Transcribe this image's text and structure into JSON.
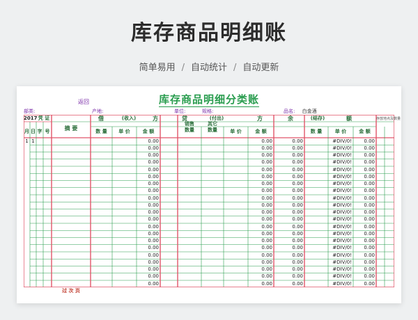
{
  "page": {
    "title": "库存商品明细账",
    "subtitle_items": [
      "简单易用",
      "自动统计",
      "自动更新"
    ],
    "subtitle_sep": "/"
  },
  "sheet": {
    "return_link": "返回",
    "ledger_title": "库存商品明细分类账",
    "info": {
      "dept_label": "部类:",
      "origin_label": "产地:",
      "unit_label": "单位:",
      "spec_label": "规格:",
      "product_label": "品名:",
      "product_value": "白金酒"
    },
    "header": {
      "year": "2017",
      "voucher": "凭  证",
      "month": "月",
      "day": "日",
      "zi": "字",
      "hao": "号",
      "summary": "摘  要",
      "debit": "借",
      "debit_note": "(收入)",
      "debit_fang": "方",
      "credit": "贷",
      "credit_note": "(付出)",
      "credit_fang": "方",
      "balance": "余",
      "balance_note": "(结存)",
      "balance_e": "额",
      "storage": "存放地点及数量",
      "qty": "数 量",
      "unit_price": "单 价",
      "amount": "金 额",
      "sales_qty_1": "销售",
      "sales_qty_2": "数量",
      "other_qty_1": "其它",
      "other_qty_2": "数量"
    },
    "first_row": {
      "month": "1",
      "day": "1"
    },
    "zero_value": "0.00",
    "div_error": "#DIV/0!",
    "row_count": 21,
    "footer": "过 次 页",
    "colors": {
      "red_line": "#e0566a",
      "green_line": "#2a9d4f",
      "title_green": "#2a9d4f",
      "purple": "#7b2ea8"
    }
  }
}
